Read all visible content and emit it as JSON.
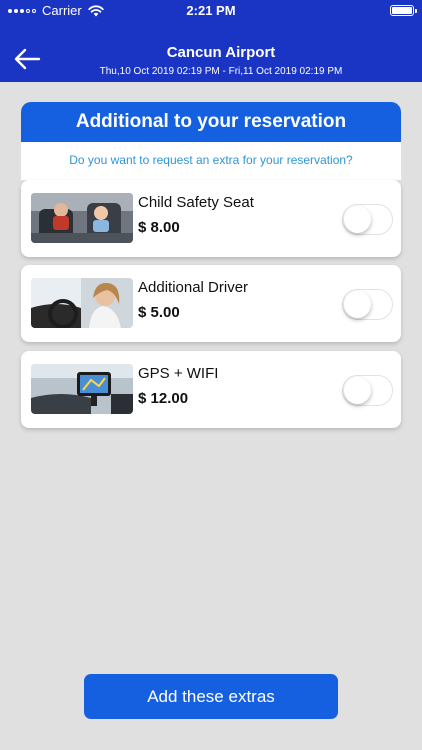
{
  "status_bar": {
    "carrier": "Carrier",
    "time": "2:21 PM"
  },
  "nav": {
    "back_icon": "arrow-left-icon",
    "title": "Cancun Airport",
    "subtitle": "Thu,10 Oct 2019 02:19 PM - Fri,11 Oct 2019 02:19 PM"
  },
  "panel": {
    "heading": "Additional to your reservation",
    "question": "Do you want to request an extra for your reservation?"
  },
  "extras": [
    {
      "title": "Child Safety Seat",
      "price": "$ 8.00",
      "image": "child-car-seat-photo",
      "toggle_on": false
    },
    {
      "title": "Additional Driver",
      "price": "$ 5.00",
      "image": "driver-photo",
      "toggle_on": false
    },
    {
      "title": "GPS + WIFI",
      "price": "$ 12.00",
      "image": "gps-device-photo",
      "toggle_on": false
    }
  ],
  "cta": {
    "label": "Add these extras"
  },
  "colors": {
    "header": "#1a34c4",
    "accent": "#1460e0",
    "question_text": "#2f96d6",
    "background": "#e0e0e0"
  }
}
